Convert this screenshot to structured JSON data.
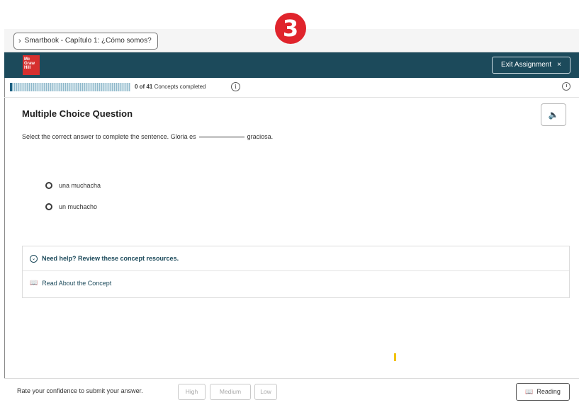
{
  "step_badge": "3",
  "breadcrumb": {
    "chevron": "›",
    "label": "Smartbook - Capítulo 1: ¿Cómo somos?"
  },
  "header": {
    "logo_lines": [
      "Mc",
      "Graw",
      "Hill"
    ],
    "exit_label": "Exit Assignment",
    "exit_icon": "×"
  },
  "progress": {
    "completed": 0,
    "total": 41,
    "fraction": 0.0,
    "count_text": "0 of 41",
    "suffix_text": "Concepts completed",
    "info_glyph": "i"
  },
  "question": {
    "title": "Multiple Choice Question",
    "prompt_before": "Select the correct answer to complete the sentence. Gloria es",
    "prompt_after": "graciosa.",
    "audio_icon": "🔈",
    "options": [
      {
        "label": "una muchacha"
      },
      {
        "label": "un muchacho"
      }
    ]
  },
  "help": {
    "chevron": "⌄",
    "heading": "Need help? Review these concept resources.",
    "link_icon": "📖",
    "link_label": "Read About the Concept"
  },
  "footer": {
    "label": "Rate your confidence to submit your answer.",
    "buttons": [
      "High",
      "Medium",
      "Low"
    ],
    "reading_icon": "📖",
    "reading_label": "Reading"
  },
  "colors": {
    "header_bg": "#1c4a5b",
    "badge": "#e0242c",
    "logo": "#d6302f"
  }
}
